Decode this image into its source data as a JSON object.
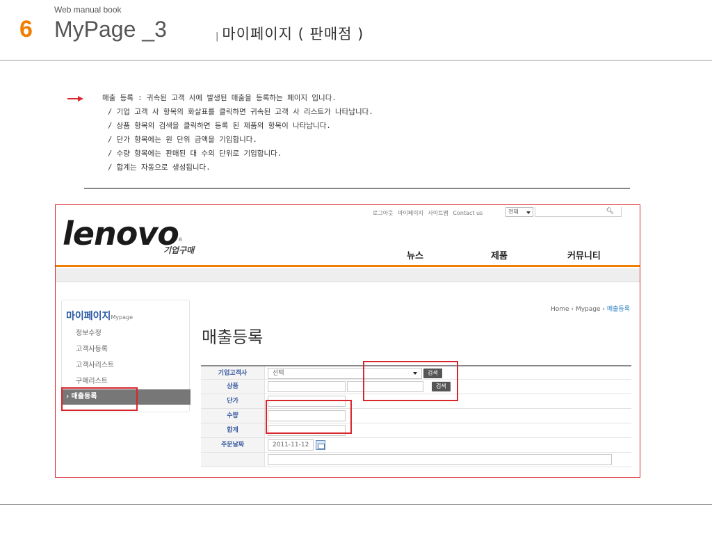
{
  "slide": {
    "subtitle_small": "Web manual book",
    "number": "6",
    "title": "MyPage _3",
    "section_bar": "|",
    "section": "마이페이지 ( 판매점 )"
  },
  "description": {
    "lines": [
      "매출 등록 : 귀속된 고객 사에 발생된 매출을 등록하는 페이지 입니다.",
      "/ 기업 고객 사 항목의 화살표를 클릭하면 귀속된 고객 사 리스트가 나타납니다.",
      "/ 상품 항목의 검색을 클릭하면 등록 된 제품의 항목이 나타납니다.",
      "/ 단가 항목에는 원 단위 금액을 기입합니다.",
      "/ 수량 항목에는 판매된 대 수의 단위로 기입합니다.",
      "/ 합계는 자동으로 생성됩니다."
    ]
  },
  "site": {
    "util_links": [
      "로그아웃",
      "마이페이지",
      "사이트맵",
      "Contact us"
    ],
    "util_select": "전체",
    "logo": "lenovo",
    "logo_reg": "®",
    "logo_sub": "기업구매",
    "nav": [
      "뉴스",
      "제품",
      "커뮤니티"
    ],
    "sidebar": {
      "title": "마이페이지",
      "title_en": "Mypage",
      "items": [
        "정보수정",
        "고객사등록",
        "고객사리스트",
        "구매리스트"
      ],
      "active": "› 매출등록"
    },
    "breadcrumb": {
      "home": "Home",
      "sep": "›",
      "mid": "Mypage",
      "current": "매출등록"
    },
    "page_title": "매출등록",
    "form": {
      "rows": [
        "기업고객사",
        "상품",
        "단가",
        "수량",
        "합계",
        "주문날짜"
      ],
      "select_value": "선택",
      "search_label": "검색",
      "date_value": "2011-11-12"
    }
  },
  "colors": {
    "accent_orange": "#f07e00",
    "highlight_red": "#d9262c",
    "link_blue": "#2b7fc0"
  }
}
